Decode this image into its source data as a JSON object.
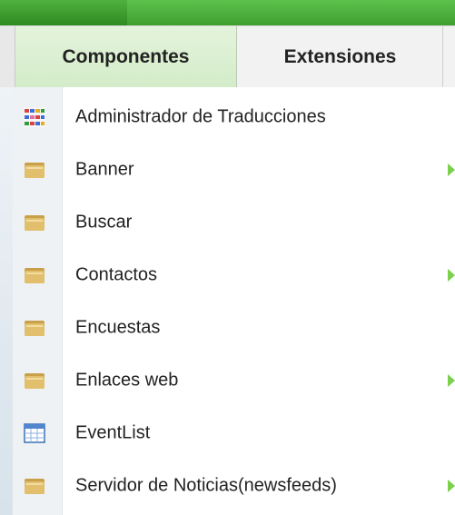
{
  "menubar": {
    "tabs": [
      {
        "label": "Componentes"
      },
      {
        "label": "Extensiones"
      }
    ]
  },
  "dropdown": {
    "items": [
      {
        "label": "Administrador de Traducciones",
        "icon": "translations-grid-icon",
        "has_submenu": false
      },
      {
        "label": "Banner",
        "icon": "folder-icon",
        "has_submenu": true
      },
      {
        "label": "Buscar",
        "icon": "folder-icon",
        "has_submenu": false
      },
      {
        "label": "Contactos",
        "icon": "folder-icon",
        "has_submenu": true
      },
      {
        "label": "Encuestas",
        "icon": "folder-icon",
        "has_submenu": false
      },
      {
        "label": "Enlaces web",
        "icon": "folder-icon",
        "has_submenu": true
      },
      {
        "label": "EventList",
        "icon": "calendar-table-icon",
        "has_submenu": false
      },
      {
        "label": "Servidor de Noticias(newsfeeds)",
        "icon": "folder-icon",
        "has_submenu": true
      }
    ]
  },
  "colors": {
    "top_strip": "#4fb13e",
    "active_tab": "#d3ecc8",
    "submenu_arrow": "#7bd04c"
  }
}
